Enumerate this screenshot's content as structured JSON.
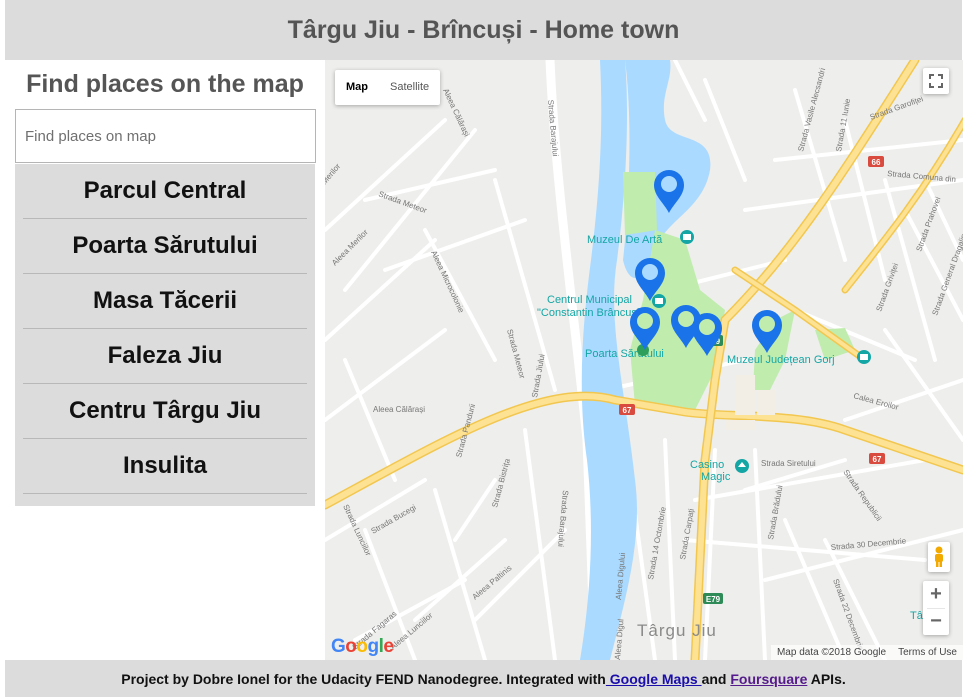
{
  "header": {
    "title": "Târgu Jiu - Brîncuși - Home town"
  },
  "sidebar": {
    "heading": "Find places on the map",
    "search_placeholder": "Find places on map",
    "places": [
      "Parcul Central",
      "Poarta Sărutului",
      "Masa Tăcerii",
      "Faleza Jiu",
      "Centru Târgu Jiu",
      "Insulita"
    ]
  },
  "map": {
    "type_controls": {
      "map": "Map",
      "satellite": "Satellite"
    },
    "labels": {
      "museum_art": "Muzeul De Artă",
      "centre_1": "Centrul Municipal",
      "centre_2": "\"Constantin Brâncuși\"",
      "poarta": "Poarta Sărutului",
      "muzeu_gorj": "Muzeul Județean Gorj",
      "casino_1": "Casino",
      "casino_2": "Magic",
      "city": "Târgu Jiu",
      "tj_edge": "Tâ"
    },
    "streets": {
      "s1": "Strada Barajului",
      "s2": "Strada Barajului",
      "s3": "Aleea Călărași",
      "s4": "Aleea Călărași",
      "s5": "Strada Meteor",
      "s6": "Aleea Merilor",
      "s7": "Aleea Microcolonie",
      "s8": "Strada Meteor",
      "s9": "Strada Lunciilor",
      "s10": "Strada Bucegi",
      "s11": "Strada Pandurii",
      "s12": "Strada Bistrița",
      "s13": "Strada Jiului",
      "s14": "Strada 14 Octombrie",
      "s15": "Strada Carpați",
      "s16": "Strada Siretului",
      "s17": "Strada Republicii",
      "s18": "Strada 30 Decembrie",
      "s19": "Strada 22 Decembrie",
      "s20": "Strada Brădului",
      "s21": "Calea Eroilor",
      "s22": "Strada Vasile Alecsandri",
      "s23": "Strada 11 Iunie",
      "s24": "Strada Comuna din",
      "s25": "Strada Garofiței",
      "s26": "Strada Griviței",
      "s27": "Strada Prahovei",
      "s28": "Strada General Dragalina",
      "s29": "Strada Fagaras",
      "s30": "Aleea Lunciilor",
      "s31": "Aleea Digului",
      "s32": "Aleea Paltinis",
      "s33": "Merilor",
      "s34": "Merilor",
      "s35": "Aleea Digul"
    },
    "road_badges": [
      "66",
      "67",
      "67",
      "E79",
      "E79"
    ],
    "attribution": "Map data ©2018 Google",
    "terms": "Terms of Use",
    "logo": "Google",
    "icons": {
      "fullscreen": "fullscreen-icon",
      "pegman": "pegman-icon",
      "marker": "map-marker-icon",
      "poi": "museum-poi-icon"
    },
    "colors": {
      "water": "#aadaff",
      "park": "#c0ecae",
      "road_major": "#fde293",
      "road_major_stroke": "#f2c750",
      "marker": "#1a73e8",
      "poi": "#14a6a5"
    },
    "markers_count": 6
  },
  "map_controls": {
    "zoom_in": "+",
    "zoom_out": "−"
  },
  "footer": {
    "prefix": "Project by Dobre Ionel for the Udacity FEND Nanodegree. Integrated with",
    "link1": " Google Maps ",
    "middle": "and ",
    "link2": "Foursquare",
    "suffix": " APIs."
  }
}
